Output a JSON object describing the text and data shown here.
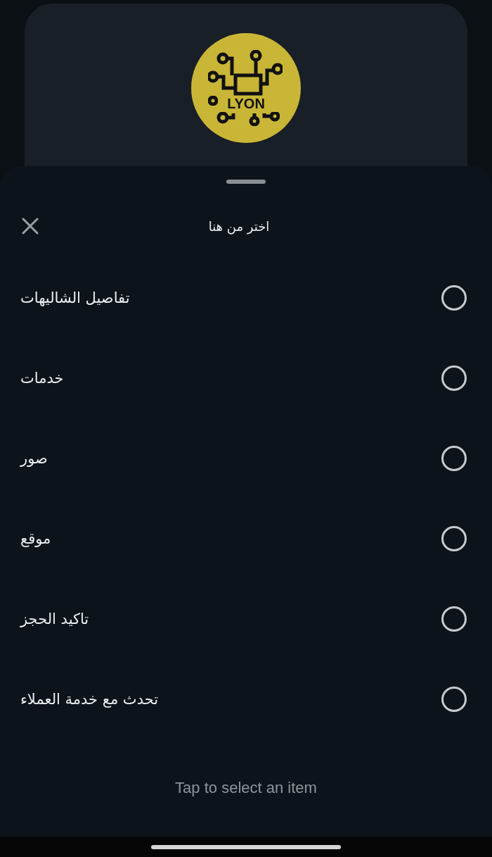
{
  "profile": {
    "logo_text": "LYON"
  },
  "sheet": {
    "title": "اختر من هنا",
    "options": [
      {
        "label": "تفاصيل الشاليهات",
        "selected": false
      },
      {
        "label": "خدمات",
        "selected": false
      },
      {
        "label": "صور",
        "selected": false
      },
      {
        "label": "موقع",
        "selected": false
      },
      {
        "label": "تاكيد الحجز",
        "selected": false
      },
      {
        "label": "تحدث مع خدمة العملاء",
        "selected": false
      }
    ],
    "hint": "Tap to select an item"
  }
}
